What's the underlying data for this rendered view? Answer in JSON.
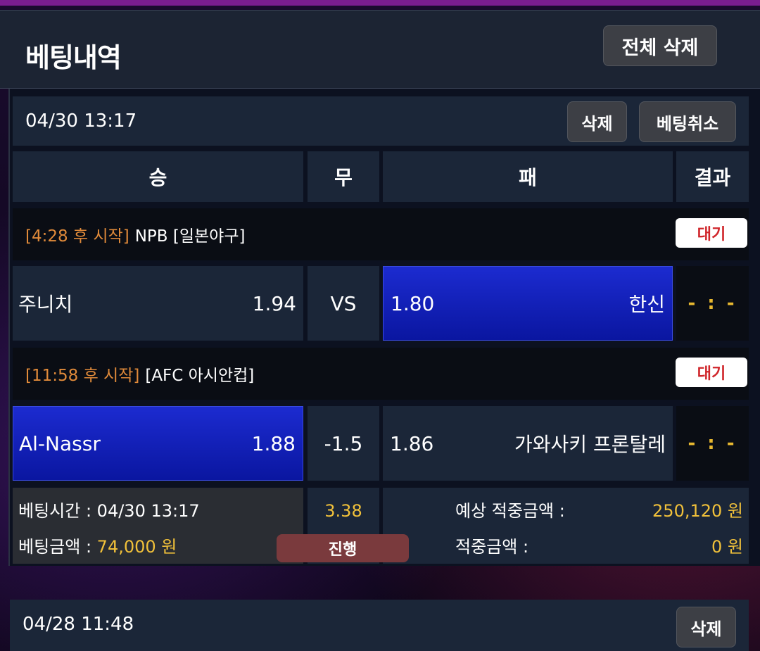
{
  "header": {
    "title": "베팅내역",
    "delete_all": "전체 삭제"
  },
  "bets": [
    {
      "date": "04/30 13:17",
      "delete_label": "삭제",
      "cancel_label": "베팅취소",
      "columns": [
        "승",
        "무",
        "패",
        "결과"
      ],
      "games": [
        {
          "time": "[4:28 후 시작]",
          "league": "NPB [일본야구]",
          "status": "대기",
          "home": "주니치",
          "home_odds": "1.94",
          "middle": "VS",
          "away_odds": "1.80",
          "away": "한신",
          "result": "- : -",
          "selected": "away"
        },
        {
          "time": "[11:58 후 시작]",
          "league": "[AFC 아시안컵]",
          "status": "대기",
          "home": "Al-Nassr",
          "home_odds": "1.88",
          "middle": "-1.5",
          "away_odds": "1.86",
          "away": "가와사키 프론탈레",
          "result": "- : -",
          "selected": "home"
        }
      ],
      "summary": {
        "bet_time_label": "베팅시간 : ",
        "bet_time": "04/30 13:17",
        "bet_amount_label": "베팅금액 : ",
        "bet_amount": "74,000 원",
        "total_odds": "3.38",
        "progress": "진행",
        "expected_label": "예상 적중금액 :",
        "expected": "250,120 원",
        "win_label": "적중금액 :",
        "win": "0 원"
      }
    },
    {
      "date": "04/28 11:48",
      "delete_label": "삭제"
    }
  ]
}
